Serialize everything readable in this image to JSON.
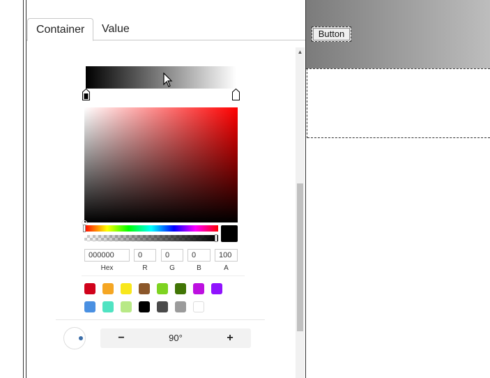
{
  "panel": {
    "top_stub": "(×)",
    "tabs": [
      {
        "label": "Container",
        "active": true
      },
      {
        "label": "Value",
        "active": false
      }
    ]
  },
  "color_picker": {
    "gradient": {
      "start_color": "#000000",
      "end_color": "#ffffff"
    },
    "current_color": "#000000",
    "hex": "000000",
    "r": "0",
    "g": "0",
    "b": "0",
    "a": "100",
    "labels": {
      "hex": "Hex",
      "r": "R",
      "g": "G",
      "b": "B",
      "a": "A"
    },
    "swatches": [
      "#d0021b",
      "#f5a623",
      "#f8e71c",
      "#8b572a",
      "#7ed321",
      "#417505",
      "#bd10e0",
      "#9013fe",
      "#4a90e2",
      "#50e3c2",
      "#b8e986",
      "#000000",
      "#4a4a4a",
      "#9b9b9b",
      "#ffffff"
    ],
    "angle": {
      "value": "90°",
      "minus_label": "−",
      "plus_label": "+"
    }
  },
  "canvas": {
    "button_label": "Button"
  }
}
